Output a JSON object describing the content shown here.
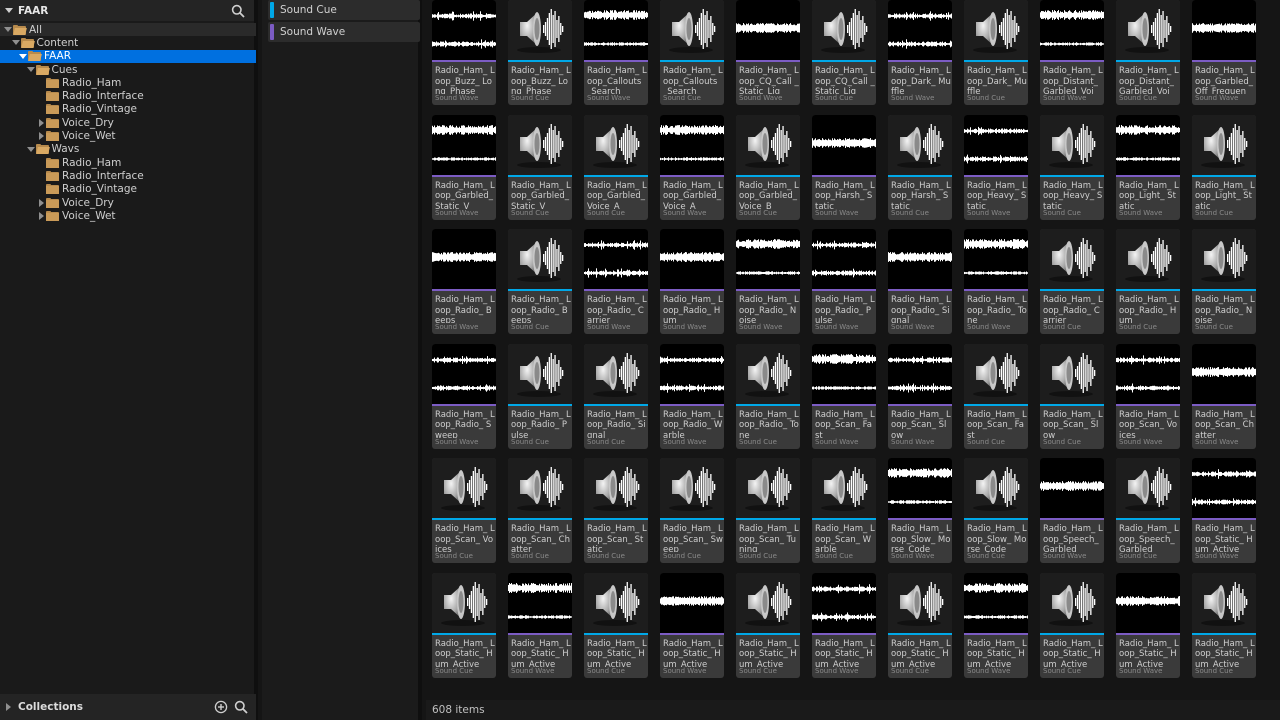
{
  "tree_header": {
    "title": "FAAR"
  },
  "tree": [
    {
      "label": "All",
      "depth": 0,
      "arrow": "down",
      "folder": "open",
      "state": "all"
    },
    {
      "label": "Content",
      "depth": 1,
      "arrow": "down",
      "folder": "open",
      "state": ""
    },
    {
      "label": "FAAR",
      "depth": 2,
      "arrow": "down",
      "folder": "open",
      "state": "sel"
    },
    {
      "label": "Cues",
      "depth": 3,
      "arrow": "down",
      "folder": "open",
      "state": ""
    },
    {
      "label": "Radio_Ham",
      "depth": 4,
      "arrow": "none",
      "folder": "closed",
      "state": ""
    },
    {
      "label": "Radio_Interface",
      "depth": 4,
      "arrow": "none",
      "folder": "closed",
      "state": ""
    },
    {
      "label": "Radio_Vintage",
      "depth": 4,
      "arrow": "none",
      "folder": "closed",
      "state": ""
    },
    {
      "label": "Voice_Dry",
      "depth": 4,
      "arrow": "right",
      "folder": "closed",
      "state": ""
    },
    {
      "label": "Voice_Wet",
      "depth": 4,
      "arrow": "right",
      "folder": "closed",
      "state": ""
    },
    {
      "label": "Wavs",
      "depth": 3,
      "arrow": "down",
      "folder": "open",
      "state": ""
    },
    {
      "label": "Radio_Ham",
      "depth": 4,
      "arrow": "none",
      "folder": "closed",
      "state": ""
    },
    {
      "label": "Radio_Interface",
      "depth": 4,
      "arrow": "none",
      "folder": "closed",
      "state": ""
    },
    {
      "label": "Radio_Vintage",
      "depth": 4,
      "arrow": "none",
      "folder": "closed",
      "state": ""
    },
    {
      "label": "Voice_Dry",
      "depth": 4,
      "arrow": "right",
      "folder": "closed",
      "state": ""
    },
    {
      "label": "Voice_Wet",
      "depth": 4,
      "arrow": "right",
      "folder": "closed",
      "state": ""
    }
  ],
  "collections": {
    "label": "Collections"
  },
  "filters": [
    {
      "label": "Sound Cue",
      "color": "#00a8e8"
    },
    {
      "label": "Sound Wave",
      "color": "#7c5cc4"
    }
  ],
  "type_labels": {
    "cue": "Sound Cue",
    "wave": "Sound Wave"
  },
  "colors": {
    "cue_accent": "#00a8e8",
    "wave_accent": "#7c5cc4",
    "selection": "#0070e0",
    "folder": "#c99a58"
  },
  "assets": [
    [
      {
        "name": "Radio_Ham_ Loop_Buzz_ Long_Phase",
        "type": "wave"
      },
      {
        "name": "Radio_Ham_ Loop_Buzz_ Long_Phase",
        "type": "cue"
      },
      {
        "name": "Radio_Ham_ Loop_Callouts _Search",
        "type": "wave"
      },
      {
        "name": "Radio_Ham_ Loop_Callouts _Search",
        "type": "cue"
      },
      {
        "name": "Radio_Ham_ Loop_CQ_Call _Static_Lig",
        "type": "wave"
      },
      {
        "name": "Radio_Ham_ Loop_CQ_Call _Static_Lig",
        "type": "cue"
      },
      {
        "name": "Radio_Ham_ Loop_Dark_ Muffle",
        "type": "wave"
      },
      {
        "name": "Radio_Ham_ Loop_Dark_ Muffle",
        "type": "cue"
      },
      {
        "name": "Radio_Ham_ Loop_Distant_ Garbled_Voi",
        "type": "wave"
      },
      {
        "name": "Radio_Ham_ Loop_Distant_ Garbled_Voi",
        "type": "cue"
      },
      {
        "name": "Radio_Ham_ Loop_Garbled_ Off_Frequen",
        "type": "wave"
      }
    ],
    [
      {
        "name": "Radio_Ham_ Loop_Garbled_ Static_V",
        "type": "wave"
      },
      {
        "name": "Radio_Ham_ Loop_Garbled_ Static_V",
        "type": "cue"
      },
      {
        "name": "Radio_Ham_ Loop_Garbled_ Voice_A",
        "type": "cue"
      },
      {
        "name": "Radio_Ham_ Loop_Garbled_ Voice_A",
        "type": "wave"
      },
      {
        "name": "Radio_Ham_ Loop_Garbled_ Voice_B",
        "type": "cue"
      },
      {
        "name": "Radio_Ham_ Loop_Harsh_ Static",
        "type": "wave"
      },
      {
        "name": "Radio_Ham_ Loop_Harsh_ Static",
        "type": "cue"
      },
      {
        "name": "Radio_Ham_ Loop_Heavy_ Static",
        "type": "wave"
      },
      {
        "name": "Radio_Ham_ Loop_Heavy_ Static",
        "type": "cue"
      },
      {
        "name": "Radio_Ham_ Loop_Light_ Static",
        "type": "wave"
      },
      {
        "name": "Radio_Ham_ Loop_Light_ Static",
        "type": "cue"
      }
    ],
    [
      {
        "name": "Radio_Ham_ Loop_Radio_ Beeps",
        "type": "wave"
      },
      {
        "name": "Radio_Ham_ Loop_Radio_ Beeps",
        "type": "cue"
      },
      {
        "name": "Radio_Ham_ Loop_Radio_ Carrier",
        "type": "wave"
      },
      {
        "name": "Radio_Ham_ Loop_Radio_ Hum",
        "type": "wave"
      },
      {
        "name": "Radio_Ham_ Loop_Radio_ Noise",
        "type": "wave"
      },
      {
        "name": "Radio_Ham_ Loop_Radio_ Pulse",
        "type": "wave"
      },
      {
        "name": "Radio_Ham_ Loop_Radio_ Signal",
        "type": "wave"
      },
      {
        "name": "Radio_Ham_ Loop_Radio_ Tone",
        "type": "wave"
      },
      {
        "name": "Radio_Ham_ Loop_Radio_ Carrier",
        "type": "cue"
      },
      {
        "name": "Radio_Ham_ Loop_Radio_ Hum",
        "type": "cue"
      },
      {
        "name": "Radio_Ham_ Loop_Radio_ Noise",
        "type": "cue"
      }
    ],
    [
      {
        "name": "Radio_Ham_ Loop_Radio_ Sweep",
        "type": "wave"
      },
      {
        "name": "Radio_Ham_ Loop_Radio_ Pulse",
        "type": "cue"
      },
      {
        "name": "Radio_Ham_ Loop_Radio_ Signal",
        "type": "cue"
      },
      {
        "name": "Radio_Ham_ Loop_Radio_ Warble",
        "type": "wave"
      },
      {
        "name": "Radio_Ham_ Loop_Radio_ Tone",
        "type": "cue"
      },
      {
        "name": "Radio_Ham_ Loop_Scan_ Fast",
        "type": "wave"
      },
      {
        "name": "Radio_Ham_ Loop_Scan_ Slow",
        "type": "wave"
      },
      {
        "name": "Radio_Ham_ Loop_Scan_ Fast",
        "type": "cue"
      },
      {
        "name": "Radio_Ham_ Loop_Scan_ Slow",
        "type": "cue"
      },
      {
        "name": "Radio_Ham_ Loop_Scan_ Voices",
        "type": "wave"
      },
      {
        "name": "Radio_Ham_ Loop_Scan_ Chatter",
        "type": "wave"
      }
    ],
    [
      {
        "name": "Radio_Ham_ Loop_Scan_ Voices",
        "type": "cue"
      },
      {
        "name": "Radio_Ham_ Loop_Scan_ Chatter",
        "type": "cue"
      },
      {
        "name": "Radio_Ham_ Loop_Scan_ Static",
        "type": "cue"
      },
      {
        "name": "Radio_Ham_ Loop_Scan_ Sweep",
        "type": "cue"
      },
      {
        "name": "Radio_Ham_ Loop_Scan_ Tuning",
        "type": "cue"
      },
      {
        "name": "Radio_Ham_ Loop_Scan_ Warble",
        "type": "cue"
      },
      {
        "name": "Radio_Ham_ Loop_Slow_ Morse_Code",
        "type": "wave"
      },
      {
        "name": "Radio_Ham_ Loop_Slow_ Morse_Code",
        "type": "cue"
      },
      {
        "name": "Radio_Ham_ Loop_Speech_ Garbled",
        "type": "wave"
      },
      {
        "name": "Radio_Ham_ Loop_Speech_ Garbled",
        "type": "cue"
      },
      {
        "name": "Radio_Ham_ Loop_Static_ Hum_Active",
        "type": "wave"
      }
    ],
    [
      {
        "name": "Radio_Ham_ Loop_Static_ Hum_Active",
        "type": "cue"
      },
      {
        "name": "Radio_Ham_ Loop_Static_ Hum_Active",
        "type": "wave"
      },
      {
        "name": "Radio_Ham_ Loop_Static_ Hum_Active",
        "type": "cue"
      },
      {
        "name": "Radio_Ham_ Loop_Static_ Hum_Active",
        "type": "wave"
      },
      {
        "name": "Radio_Ham_ Loop_Static_ Hum_Active",
        "type": "cue"
      },
      {
        "name": "Radio_Ham_ Loop_Static_ Hum_Active",
        "type": "wave"
      },
      {
        "name": "Radio_Ham_ Loop_Static_ Hum_Active",
        "type": "cue"
      },
      {
        "name": "Radio_Ham_ Loop_Static_ Hum_Active",
        "type": "wave"
      },
      {
        "name": "Radio_Ham_ Loop_Static_ Hum_Active",
        "type": "cue"
      },
      {
        "name": "Radio_Ham_ Loop_Static_ Hum_Active",
        "type": "wave"
      },
      {
        "name": "Radio_Ham_ Loop_Static_ Hum_Active",
        "type": "cue"
      }
    ]
  ],
  "status": {
    "item_count": "608 items"
  }
}
